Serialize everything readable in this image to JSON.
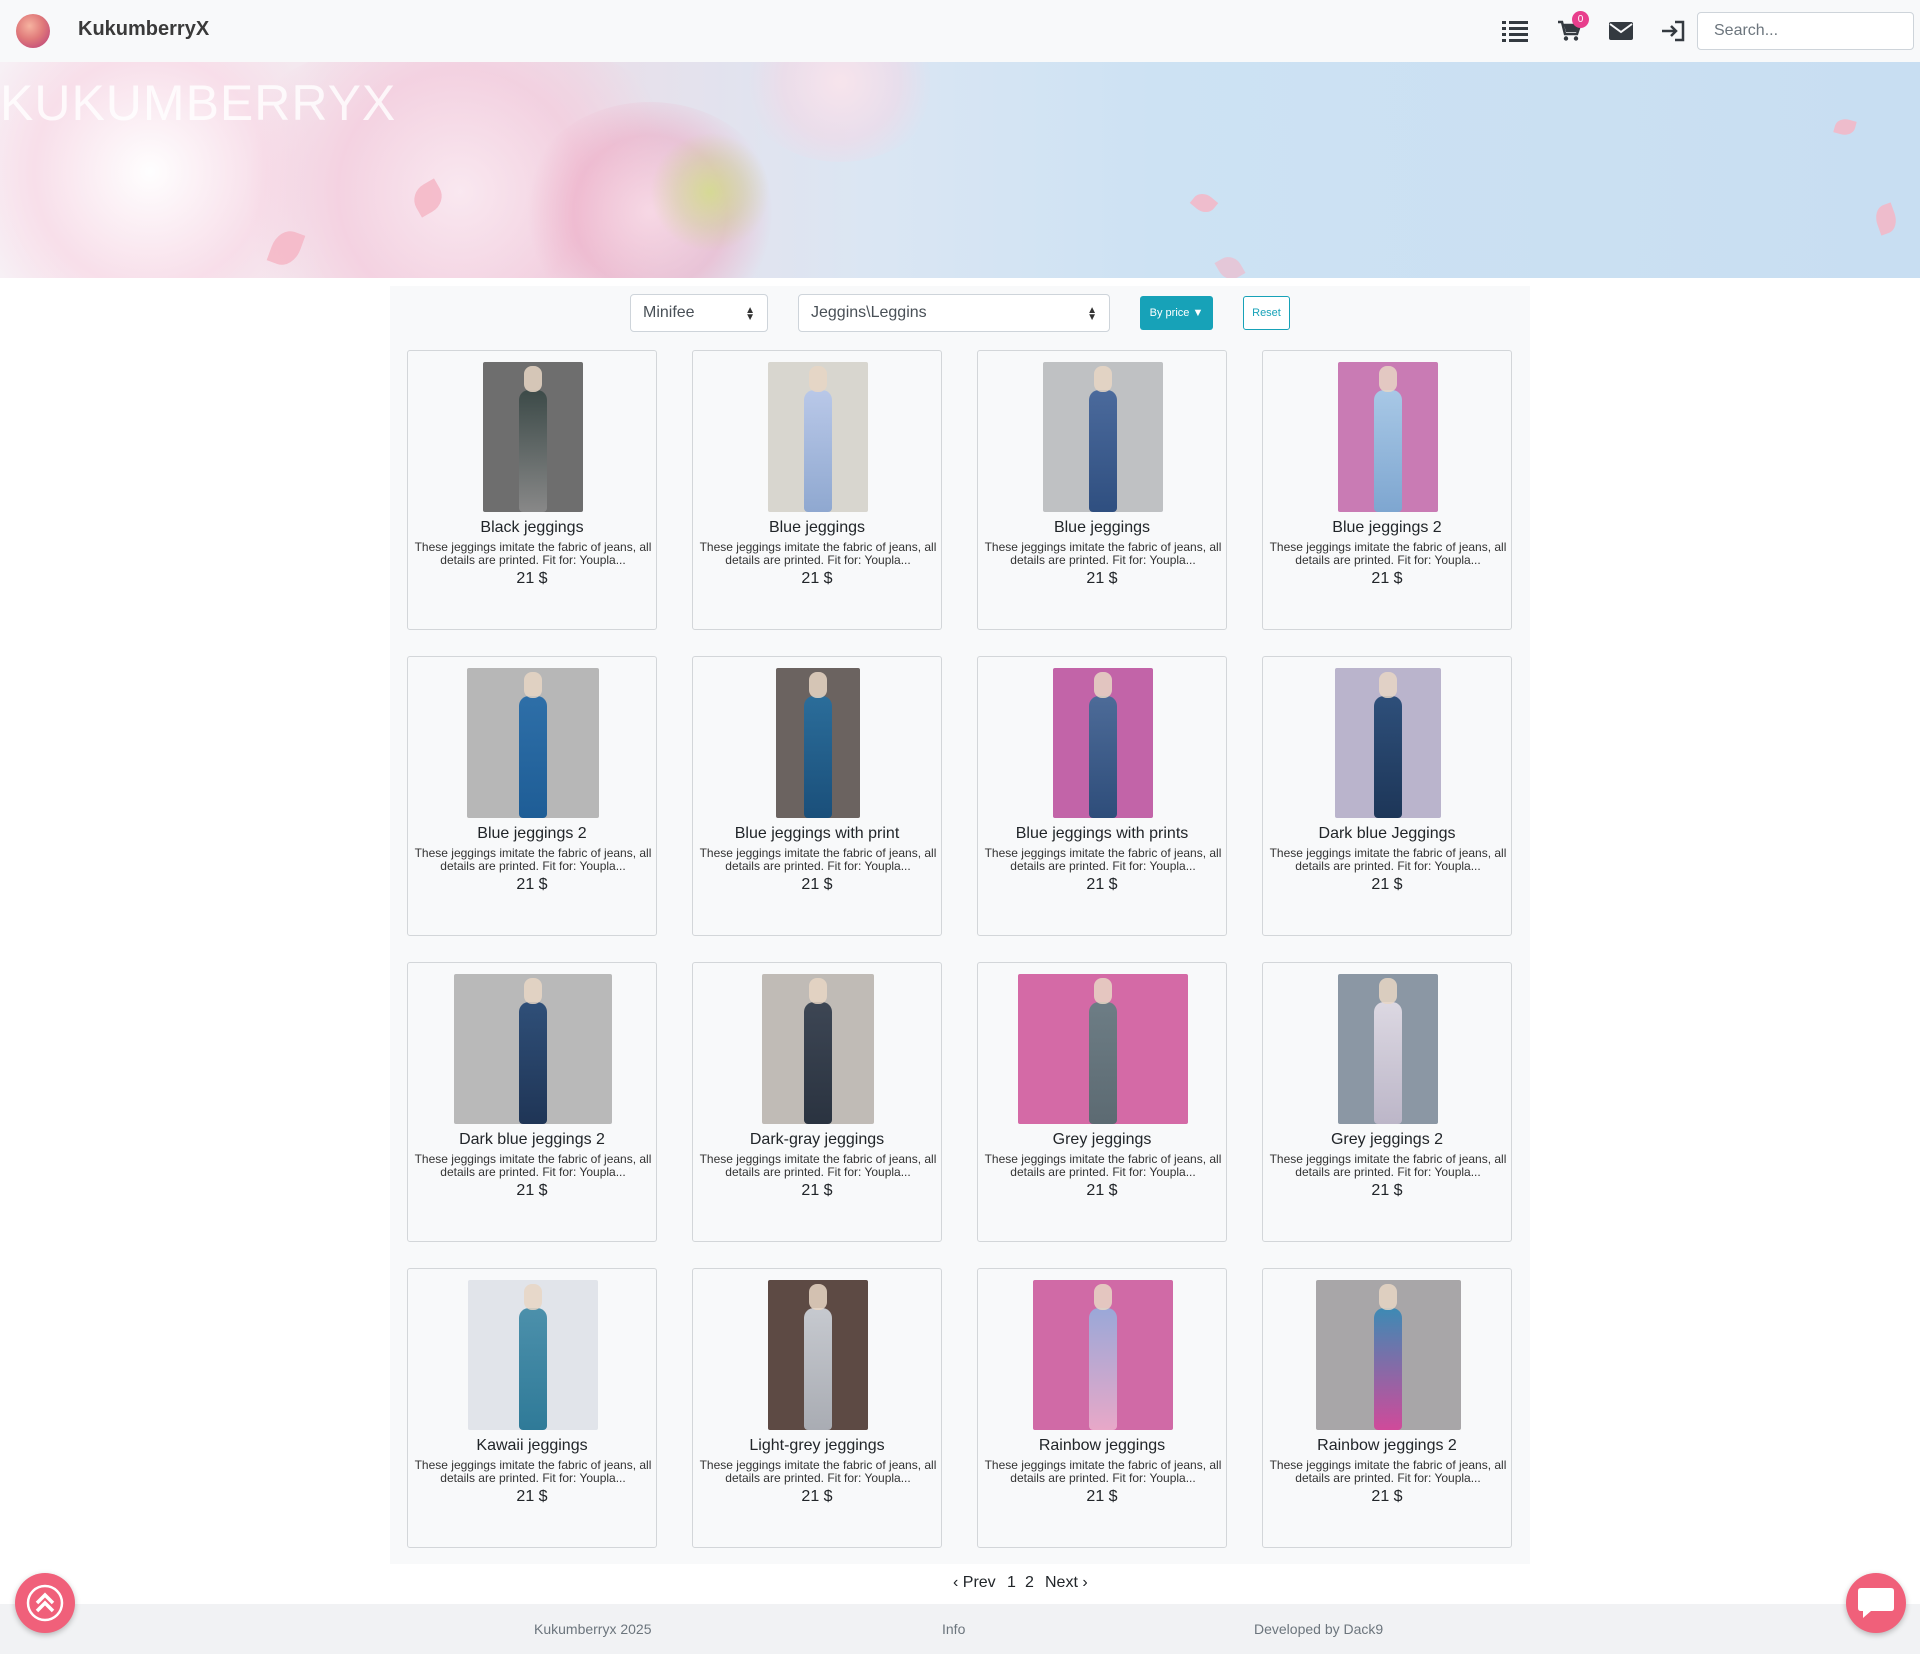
{
  "header": {
    "brand": "KukumberryX",
    "cart_count": "0",
    "search_placeholder": "Search...",
    "icons": [
      "list-icon",
      "cart-icon",
      "mail-icon",
      "login-icon"
    ]
  },
  "banner": {
    "title": "KUKUMBERRYX"
  },
  "filters": {
    "size_select": "Minifee",
    "category_select": "Jeggins\\Leggins",
    "sort_button": "By price ▼",
    "reset_button": "Reset"
  },
  "products": [
    {
      "name": "Black jeggings",
      "desc": "These jeggings imitate the fabric of jeans, all details are printed. Fit for: Youpla...",
      "price": "21 $"
    },
    {
      "name": "Blue jeggings",
      "desc": "These jeggings imitate the fabric of jeans, all details are printed. Fit for: Youpla...",
      "price": "21 $"
    },
    {
      "name": "Blue jeggings",
      "desc": "These jeggings imitate the fabric of jeans, all details are printed. Fit for: Youpla...",
      "price": "21 $"
    },
    {
      "name": "Blue jeggings 2",
      "desc": "These jeggings imitate the fabric of jeans, all details are printed. Fit for: Youpla...",
      "price": "21 $"
    },
    {
      "name": "Blue jeggings 2",
      "desc": "These jeggings imitate the fabric of jeans, all details are printed. Fit for: Youpla...",
      "price": "21 $"
    },
    {
      "name": "Blue jeggings with print",
      "desc": "These jeggings imitate the fabric of jeans, all details are printed. Fit for: Youpla...",
      "price": "21 $"
    },
    {
      "name": "Blue jeggings with prints",
      "desc": "These jeggings imitate the fabric of jeans, all details are printed. Fit for: Youpla...",
      "price": "21 $"
    },
    {
      "name": "Dark blue Jeggings",
      "desc": "These jeggings imitate the fabric of jeans, all details are printed. Fit for: Youpla...",
      "price": "21 $"
    },
    {
      "name": "Dark blue jeggings 2",
      "desc": "These jeggings imitate the fabric of jeans, all details are printed. Fit for: Youpla...",
      "price": "21 $"
    },
    {
      "name": "Dark-gray jeggings",
      "desc": "These jeggings imitate the fabric of jeans, all details are printed. Fit for: Youpla...",
      "price": "21 $"
    },
    {
      "name": "Grey jeggings",
      "desc": "These jeggings imitate the fabric of jeans, all details are printed. Fit for: Youpla...",
      "price": "21 $"
    },
    {
      "name": "Grey jeggings 2",
      "desc": "These jeggings imitate the fabric of jeans, all details are printed. Fit for: Youpla...",
      "price": "21 $"
    },
    {
      "name": "Kawaii jeggings",
      "desc": "These jeggings imitate the fabric of jeans, all details are printed. Fit for: Youpla...",
      "price": "21 $"
    },
    {
      "name": "Light-grey jeggings",
      "desc": "These jeggings imitate the fabric of jeans, all details are printed. Fit for: Youpla...",
      "price": "21 $"
    },
    {
      "name": "Rainbow jeggings",
      "desc": "These jeggings imitate the fabric of jeans, all details are printed. Fit for: Youpla...",
      "price": "21 $"
    },
    {
      "name": "Rainbow jeggings 2",
      "desc": "These jeggings imitate the fabric of jeans, all details are printed. Fit for: Youpla...",
      "price": "21 $"
    }
  ],
  "pagination": {
    "prev": "‹ Prev",
    "page1": "1",
    "page2": "2",
    "next": "Next ›"
  },
  "footer": {
    "copyright": "Kukumberryx 2025",
    "info": "Info",
    "developer": "Developed by Dack9"
  }
}
